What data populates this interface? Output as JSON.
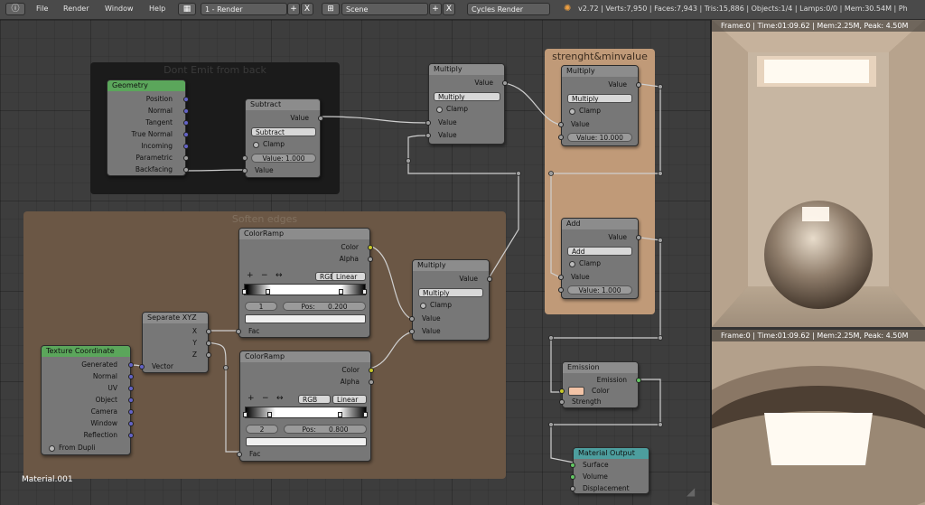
{
  "topbar": {
    "menus": [
      "File",
      "Render",
      "Window",
      "Help"
    ],
    "screen_layout": "1 - Render",
    "scene": "Scene",
    "engine": "Cycles Render",
    "stats": "v2.72 | Verts:7,950 | Faces:7,943 | Tris:15,886 | Objects:1/4 | Lamps:0/0 | Mem:30.54M | Ph",
    "btn_add": "+",
    "btn_close": "X"
  },
  "frames": {
    "dont_emit": "Dont Emit from back",
    "soften": "Soften edges",
    "strength": "strenght&minvalue"
  },
  "nodes": {
    "geometry": {
      "title": "Geometry",
      "outputs": [
        "Position",
        "Normal",
        "Tangent",
        "True Normal",
        "Incoming",
        "Parametric",
        "Backfacing"
      ]
    },
    "subtract": {
      "title": "Subtract",
      "out": "Value",
      "op": "Subtract",
      "clamp": "Clamp",
      "value_field": "Value:",
      "value": "1.000",
      "in": "Value"
    },
    "multiply_top": {
      "title": "Multiply",
      "out": "Value",
      "op": "Multiply",
      "clamp": "Clamp",
      "in1": "Value",
      "in2": "Value"
    },
    "multiply_strength": {
      "title": "Multiply",
      "out": "Value",
      "op": "Multiply",
      "clamp": "Clamp",
      "in1": "Value",
      "value_field": "Value:",
      "value": "10.000"
    },
    "add": {
      "title": "Add",
      "out": "Value",
      "op": "Add",
      "clamp": "Clamp",
      "in1": "Value",
      "value_field": "Value:",
      "value": "1.000"
    },
    "colorramp1": {
      "title": "ColorRamp",
      "out1": "Color",
      "out2": "Alpha",
      "plus": "+",
      "minus": "−",
      "flip": "↔",
      "mode": "RGB",
      "interp": "Linear",
      "index": "1",
      "pos_label": "Pos:",
      "pos": "0.200",
      "in": "Fac"
    },
    "colorramp2": {
      "title": "ColorRamp",
      "out1": "Color",
      "out2": "Alpha",
      "plus": "+",
      "minus": "−",
      "flip": "↔",
      "mode": "RGB",
      "interp": "Linear",
      "index": "2",
      "pos_label": "Pos:",
      "pos": "0.800",
      "in": "Fac"
    },
    "multiply_mid": {
      "title": "Multiply",
      "out": "Value",
      "op": "Multiply",
      "clamp": "Clamp",
      "in1": "Value",
      "in2": "Value"
    },
    "separate_xyz": {
      "title": "Separate XYZ",
      "out_x": "X",
      "out_y": "Y",
      "out_z": "Z",
      "in": "Vector"
    },
    "texcoord": {
      "title": "Texture Coordinate",
      "outputs": [
        "Generated",
        "Normal",
        "UV",
        "Object",
        "Camera",
        "Window",
        "Reflection"
      ],
      "from_dupli": "From Dupli"
    },
    "emission": {
      "title": "Emission",
      "out": "Emission",
      "in_color": "Color",
      "in_strength": "Strength",
      "color": "#f2c3a6"
    },
    "material_output": {
      "title": "Material Output",
      "in1": "Surface",
      "in2": "Volume",
      "in3": "Displacement"
    }
  },
  "material_name": "Material.001",
  "render_top": {
    "info": "Frame:0 | Time:01:09.62 | Mem:2.25M, Peak: 4.50M"
  },
  "render_bottom": {
    "info": "Frame:0 | Time:01:09.62 | Mem:2.25M, Peak: 4.50M"
  },
  "colors": {
    "socket_value": "#9e9e9e",
    "socket_color": "#c7c729",
    "socket_vector": "#6363c7",
    "socket_shader": "#63c763"
  }
}
